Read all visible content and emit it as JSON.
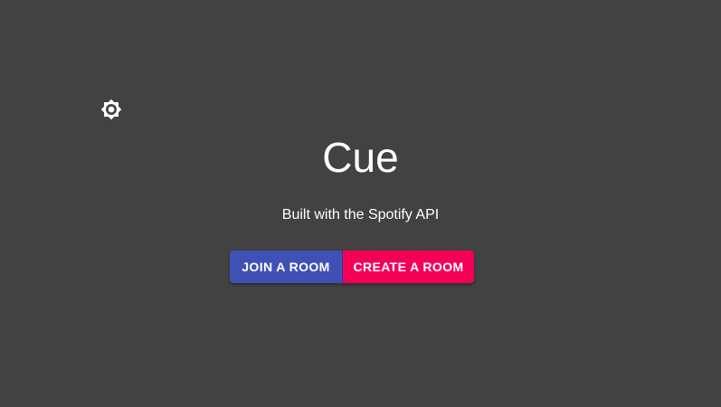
{
  "app": {
    "title": "Cue",
    "subtitle": "Built with the Spotify API"
  },
  "header": {
    "theme_toggle_icon": "brightness-icon"
  },
  "actions": {
    "join_label": "JOIN A ROOM",
    "create_label": "CREATE A ROOM"
  },
  "colors": {
    "background": "#424242",
    "primary": "#3f51b5",
    "secondary": "#f50057",
    "text": "#ffffff"
  }
}
